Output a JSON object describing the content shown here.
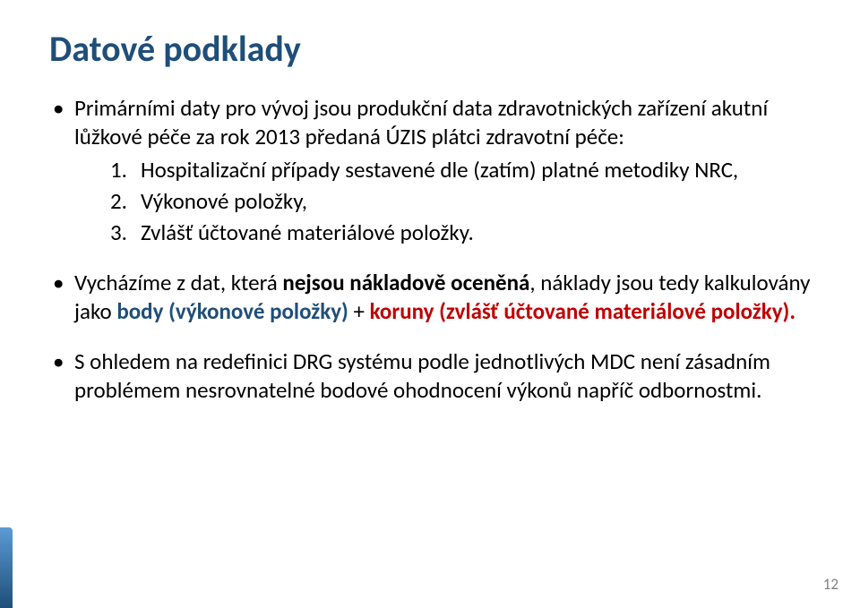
{
  "title": "Datové podklady",
  "bullets": {
    "b1": {
      "lead": "Primárními daty pro vývoj jsou produkční data zdravotnických zařízení akutní lůžkové péče za rok 2013 předaná ÚZIS plátci zdravotní péče:",
      "items": [
        "Hospitalizační případy sestavené dle (zatím) platné metodiky NRC,",
        "Výkonové položky,",
        "Zvlášť účtované materiálové položky."
      ]
    },
    "b2": {
      "t1": "Vycházíme z dat, která ",
      "t2": "nejsou nákladově oceněná",
      "t3": ", náklady jsou tedy kalkulovány jako ",
      "t4": "body (výkonové položky) ",
      "t5": "+ ",
      "t6": "koruny (zvlášť účtované materiálové položky).",
      "t7": ""
    },
    "b3": "S ohledem na redefinici DRG systému podle jednotlivých MDC není zásadním problémem nesrovnatelné bodové ohodnocení výkonů napříč odbornostmi."
  },
  "page": "12"
}
